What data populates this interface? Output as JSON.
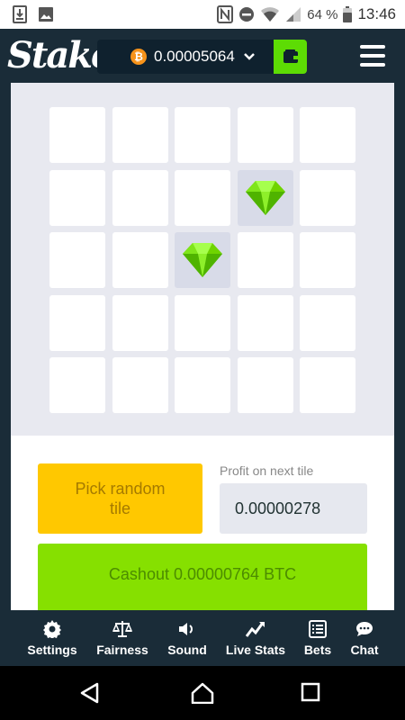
{
  "status_bar": {
    "battery": "64 %",
    "time": "13:46",
    "icons_left": [
      "download-icon",
      "image-icon"
    ],
    "icons_right": [
      "nfc-icon",
      "do-not-disturb-icon",
      "wifi-icon",
      "signal-icon",
      "battery-icon"
    ]
  },
  "header": {
    "logo": "Stake",
    "balance": "0.00005064",
    "currency_icon": "bitcoin-icon",
    "wallet_icon": "wallet-icon",
    "menu_icon": "hamburger-menu-icon"
  },
  "grid": {
    "rows": 5,
    "cols": 5,
    "revealed_gems": [
      [
        1,
        3
      ],
      [
        2,
        2
      ]
    ]
  },
  "controls": {
    "random_button": "Pick random tile",
    "profit_label": "Profit on next tile",
    "profit_value": "0.00000278",
    "cashout_button": "Cashout 0.00000764 BTC"
  },
  "tabs": [
    {
      "label": "Settings",
      "icon": "gear-icon"
    },
    {
      "label": "Fairness",
      "icon": "scales-icon"
    },
    {
      "label": "Sound",
      "icon": "speaker-icon"
    },
    {
      "label": "Live Stats",
      "icon": "trend-icon"
    },
    {
      "label": "Bets",
      "icon": "list-icon"
    },
    {
      "label": "Chat",
      "icon": "chat-bubble-icon"
    }
  ],
  "colors": {
    "header_bg": "#1a2c38",
    "random_button": "#ffc800",
    "cashout_button": "#86e000",
    "gem": "#6fd400"
  }
}
